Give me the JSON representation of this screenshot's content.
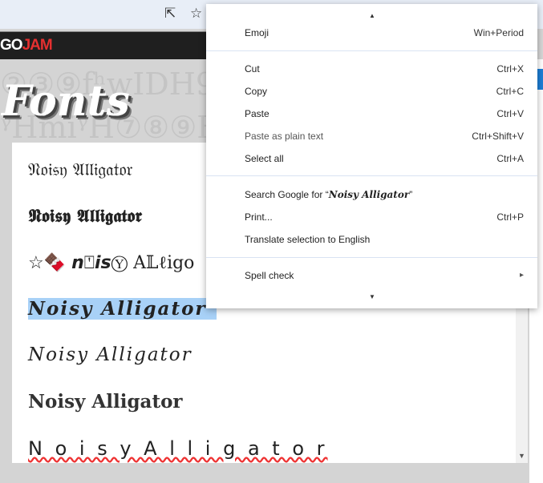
{
  "browser": {
    "share_icon": "share-icon",
    "bookmark_icon": "star-icon"
  },
  "site": {
    "logo_part1": "GO",
    "logo_part2": "JAM",
    "page_title": "Fonts",
    "background_pattern": "②③⑨fʰwIDH9②③ ⓥⓙKSVⓘKSV ᵞHmiᵞH⑦⑧⑨H⑧12"
  },
  "font_samples": [
    "𝔑𝔬𝔦𝔰𝔶 𝔄𝔩𝔩𝔦𝔤𝔞𝔱𝔬𝔯",
    "𝕹𝖔𝖎𝖘𝖞 𝕬𝖑𝖑𝖎𝖌𝖆𝖙𝖔𝖗",
    "☆🍫 𝙣⍞𝙞𝙨Ⓨ A𝕃ℓigo",
    "Noisy Alligator",
    "Noisy Alligator",
    "Noisy Alligator",
    "N o i s y  A l l i g a t o r"
  ],
  "context_menu": {
    "items": [
      {
        "label": "Emoji",
        "shortcut": "Win+Period"
      },
      {
        "label": "Cut",
        "shortcut": "Ctrl+X"
      },
      {
        "label": "Copy",
        "shortcut": "Ctrl+C"
      },
      {
        "label": "Paste",
        "shortcut": "Ctrl+V"
      },
      {
        "label": "Paste as plain text",
        "shortcut": "Ctrl+Shift+V"
      },
      {
        "label": "Select all",
        "shortcut": "Ctrl+A"
      },
      {
        "label": "Search Google for “",
        "query": "Noisy Alligator",
        "suffix": "”"
      },
      {
        "label": "Print...",
        "shortcut": "Ctrl+P"
      },
      {
        "label": "Translate selection to English"
      },
      {
        "label": "Spell check",
        "submenu": "▸"
      }
    ],
    "scroll_up": "▲",
    "scroll_down": "▼"
  },
  "colors": {
    "selection": "#a8d1f7",
    "logo_red": "#e53030",
    "header": "#1f1f1f"
  }
}
